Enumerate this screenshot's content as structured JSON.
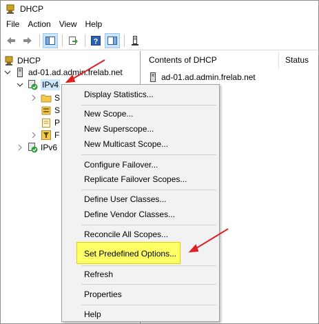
{
  "window": {
    "title": "DHCP",
    "title_icon": "dhcp-icon"
  },
  "menubar": {
    "items": [
      "File",
      "Action",
      "View",
      "Help"
    ]
  },
  "toolbar": {
    "buttons": [
      "back-arrow-icon",
      "forward-arrow-icon",
      "show-hide-tree-icon",
      "export-list-icon",
      "help-icon",
      "show-action-pane-icon",
      "server-icon"
    ]
  },
  "tree": {
    "root": "DHCP",
    "server": "ad-01.ad.admin.frelab.net",
    "ipv4": "IPv4",
    "ipv4_children": [
      "S",
      "S",
      "P",
      "F"
    ],
    "ipv6": "IPv6"
  },
  "content": {
    "col_contents": "Contents of DHCP",
    "col_status": "Status",
    "rows": [
      "ad-01.ad.admin.frelab.net"
    ]
  },
  "context_menu": {
    "items": [
      "Display Statistics...",
      "New Scope...",
      "New Superscope...",
      "New Multicast Scope...",
      "Configure Failover...",
      "Replicate Failover Scopes...",
      "Define User Classes...",
      "Define Vendor Classes...",
      "Reconcile All Scopes...",
      "Set Predefined Options...",
      "Refresh",
      "Properties",
      "Help"
    ],
    "highlighted_item": "Set Predefined Options..."
  },
  "annotations": {
    "arrow_color": "#e02020",
    "highlight_color": "#ffff66"
  }
}
